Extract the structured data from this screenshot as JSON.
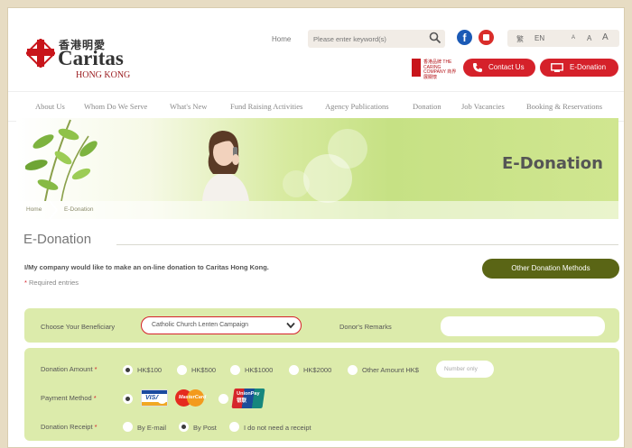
{
  "header": {
    "logo_zh": "香港明愛",
    "logo_en": "Caritas",
    "logo_sub": "HONG KONG",
    "home_link": "Home",
    "search_placeholder": "Please enter keyword(s)",
    "lang_tc": "繁",
    "lang_en": "EN",
    "font_small": "A",
    "font_medium": "A",
    "font_large": "A",
    "award_text": "香港品牌 THE CARING COMPANY 商界展關懷",
    "contact_label": "Contact Us",
    "edonation_label": "E-Donation"
  },
  "nav": {
    "items": [
      "About Us",
      "Whom Do We Serve",
      "What's New",
      "Fund Raising Activities",
      "Agency Publications",
      "Donation",
      "Job Vacancies",
      "Booking & Reservations"
    ]
  },
  "banner": {
    "title": "E-Donation",
    "breadcrumb_home": "Home",
    "breadcrumb_current": "E-Donation"
  },
  "main": {
    "section_title": "E-Donation",
    "intro": "I/My company would like to make an on-line donation to Caritas Hong Kong.",
    "required_note": "Required entries",
    "other_methods_label": "Other Donation Methods"
  },
  "form": {
    "beneficiary_label": "Choose Your Beneficiary",
    "beneficiary_value": "Catholic Church Lenten Campaign",
    "remarks_label": "Donor's Remarks",
    "remarks_value": "",
    "amount_label": "Donation Amount",
    "amount_options": [
      "HK$100",
      "HK$500",
      "HK$1000",
      "HK$2000",
      "Other Amount HK$"
    ],
    "amount_selected": "HK$100",
    "amount_placeholder": "Number only",
    "payment_label": "Payment Method",
    "payment_options": [
      "VISA",
      "MasterCard",
      "UnionPay 银联"
    ],
    "payment_selected": "VISA",
    "receipt_label": "Donation Receipt",
    "receipt_options": [
      "By E-mail",
      "By Post",
      "I do not need a receipt"
    ],
    "receipt_selected": "By Post",
    "required_mark": "*"
  },
  "colors": {
    "brand_red": "#d5212a",
    "olive_button": "#5a6515",
    "panel_green": "#dcebab",
    "page_bg": "#e7dcc3"
  }
}
